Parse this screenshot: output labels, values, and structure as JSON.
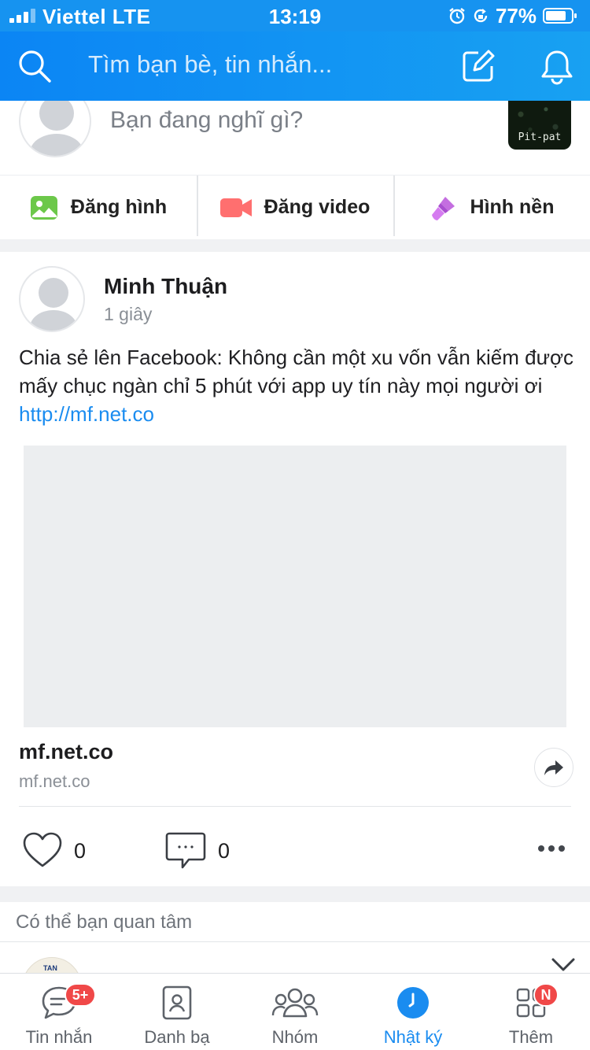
{
  "status_bar": {
    "carrier": "Viettel",
    "network": "LTE",
    "time": "13:19",
    "battery_percent": "77%",
    "icons": [
      "signal-icon",
      "alarm-icon",
      "rotation-lock-icon",
      "battery-icon"
    ]
  },
  "header": {
    "search_placeholder": "Tìm bạn bè, tin nhắn...",
    "icons": [
      "search-icon",
      "compose-icon",
      "bell-icon"
    ]
  },
  "composer": {
    "placeholder": "Bạn đang nghĩ gì?",
    "thumbnail_caption": "Pit-pat"
  },
  "actions": [
    {
      "label": "Đăng hình",
      "icon": "photo-icon"
    },
    {
      "label": "Đăng video",
      "icon": "video-icon"
    },
    {
      "label": "Hình nền",
      "icon": "brush-icon"
    }
  ],
  "post": {
    "author": "Minh Thuận",
    "time": "1 giây",
    "text": "Chia sẻ lên Facebook: Không cần một xu vốn vẫn kiếm được mấy chục ngàn chỉ 5 phút với app uy tín này mọi người ơi ",
    "link": "http://mf.net.co",
    "link_preview": {
      "title": "mf.net.co",
      "domain": "mf.net.co"
    },
    "likes": "0",
    "comments": "0"
  },
  "suggestions": {
    "title": "Có thể bạn quan tâm",
    "avatar_text": "TAN"
  },
  "tab_bar": {
    "tabs": [
      {
        "label": "Tin nhắn",
        "badge": "5+",
        "icon": "chat-icon"
      },
      {
        "label": "Danh bạ",
        "icon": "contacts-icon"
      },
      {
        "label": "Nhóm",
        "icon": "group-icon"
      },
      {
        "label": "Nhật ký",
        "icon": "timeline-icon",
        "active": true
      },
      {
        "label": "Thêm",
        "badge": "N",
        "icon": "grid-icon"
      }
    ]
  },
  "colors": {
    "brand_blue": "#1693f0",
    "link_blue": "#1a8cf0",
    "badge_red": "#f04848"
  }
}
